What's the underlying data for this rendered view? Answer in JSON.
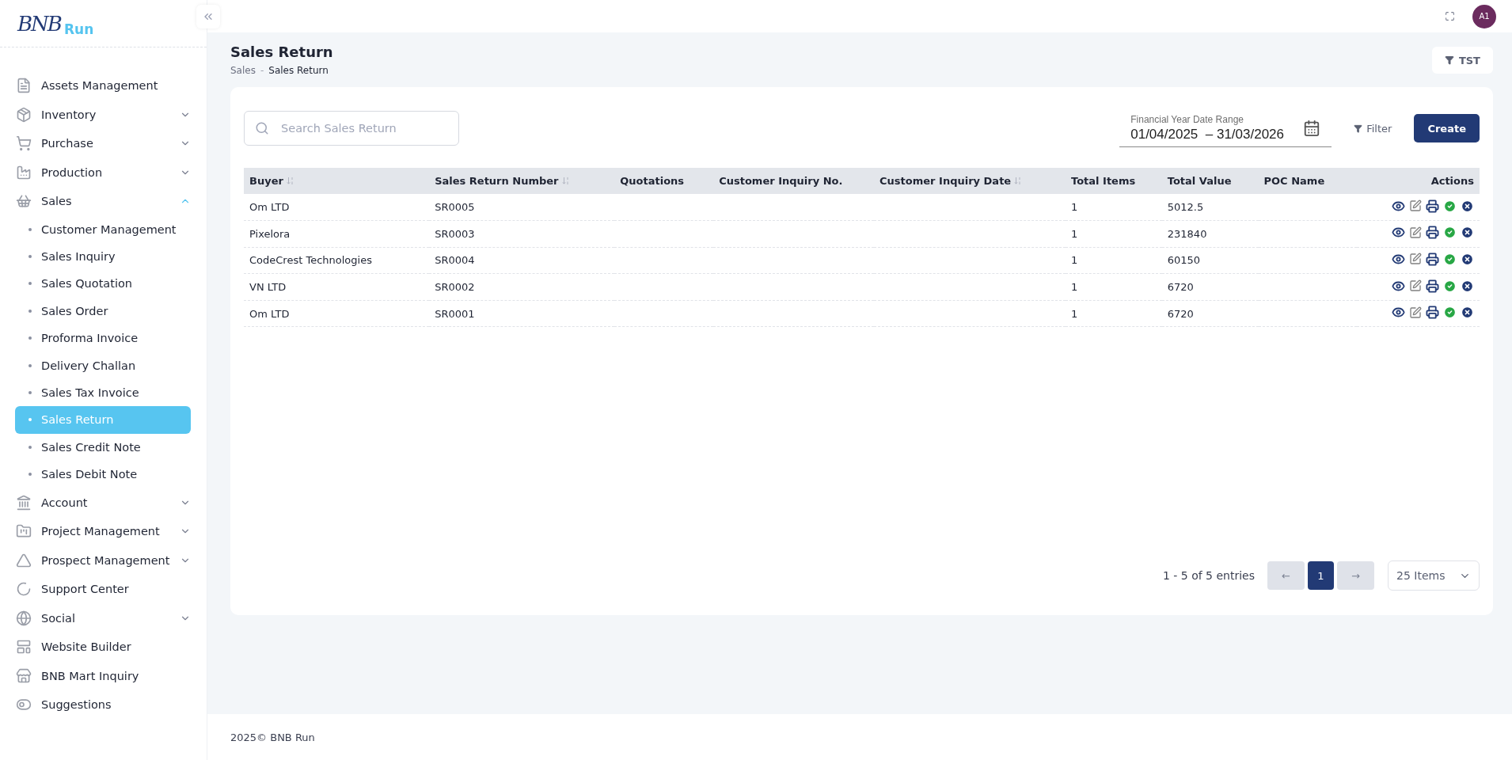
{
  "brand": {
    "mark": "BNB",
    "name": "Run"
  },
  "sidebar": {
    "items": [
      {
        "label": "Assets Management",
        "expandable": false
      },
      {
        "label": "Inventory",
        "expandable": true,
        "expanded": false
      },
      {
        "label": "Purchase",
        "expandable": true,
        "expanded": false
      },
      {
        "label": "Production",
        "expandable": true,
        "expanded": false
      },
      {
        "label": "Sales",
        "expandable": true,
        "expanded": true,
        "children": [
          {
            "label": "Customer Management",
            "selected": false
          },
          {
            "label": "Sales Inquiry",
            "selected": false
          },
          {
            "label": "Sales Quotation",
            "selected": false
          },
          {
            "label": "Sales Order",
            "selected": false
          },
          {
            "label": "Proforma Invoice",
            "selected": false
          },
          {
            "label": "Delivery Challan",
            "selected": false
          },
          {
            "label": "Sales Tax Invoice",
            "selected": false
          },
          {
            "label": "Sales Return",
            "selected": true
          },
          {
            "label": "Sales Credit Note",
            "selected": false
          },
          {
            "label": "Sales Debit Note",
            "selected": false
          }
        ]
      },
      {
        "label": "Account",
        "expandable": true,
        "expanded": false
      },
      {
        "label": "Project Management",
        "expandable": true,
        "expanded": false
      },
      {
        "label": "Prospect Management",
        "expandable": true,
        "expanded": false
      },
      {
        "label": "Support Center",
        "expandable": false
      },
      {
        "label": "Social",
        "expandable": true,
        "expanded": false
      },
      {
        "label": "Website Builder",
        "expandable": false
      },
      {
        "label": "BNB Mart Inquiry",
        "expandable": false
      },
      {
        "label": "Suggestions",
        "expandable": false
      }
    ]
  },
  "topbar": {
    "avatar": "A1"
  },
  "page": {
    "title": "Sales Return",
    "breadcrumb": [
      "Sales",
      "Sales Return"
    ],
    "breadcrumb_separator": "-",
    "company_button": "TST"
  },
  "toolbar": {
    "search": {
      "placeholder": "Search Sales Return"
    },
    "date_range": {
      "label": "Financial Year Date Range",
      "value": "01/04/2025  – 31/03/2026"
    },
    "filter": "Filter",
    "create": "Create"
  },
  "table": {
    "columns": [
      {
        "label": "Buyer",
        "sortable": true
      },
      {
        "label": "Sales Return Number",
        "sortable": true
      },
      {
        "label": "Quotations",
        "sortable": false
      },
      {
        "label": "Customer Inquiry No.",
        "sortable": false
      },
      {
        "label": "Customer Inquiry Date",
        "sortable": true
      },
      {
        "label": "Total Items",
        "sortable": false
      },
      {
        "label": "Total Value",
        "sortable": false
      },
      {
        "label": "POC Name",
        "sortable": false
      },
      {
        "label": "Actions",
        "sortable": false
      }
    ],
    "rows": [
      [
        "Om LTD",
        "SR0005",
        "",
        "",
        "",
        "1",
        "5012.5",
        ""
      ],
      [
        "Pixelora",
        "SR0003",
        "",
        "",
        "",
        "1",
        "231840",
        ""
      ],
      [
        "CodeCrest Technologies",
        "SR0004",
        "",
        "",
        "",
        "1",
        "60150",
        ""
      ],
      [
        "VN LTD",
        "SR0002",
        "",
        "",
        "",
        "1",
        "6720",
        ""
      ],
      [
        "Om LTD",
        "SR0001",
        "",
        "",
        "",
        "1",
        "6720",
        ""
      ]
    ]
  },
  "pagination": {
    "summary": "1 - 5 of 5 entries",
    "prev": "←",
    "pages": [
      {
        "label": "1",
        "selected": true
      }
    ],
    "next": "→",
    "page_size": "25 Items"
  },
  "footer": "2025© BNB Run"
}
